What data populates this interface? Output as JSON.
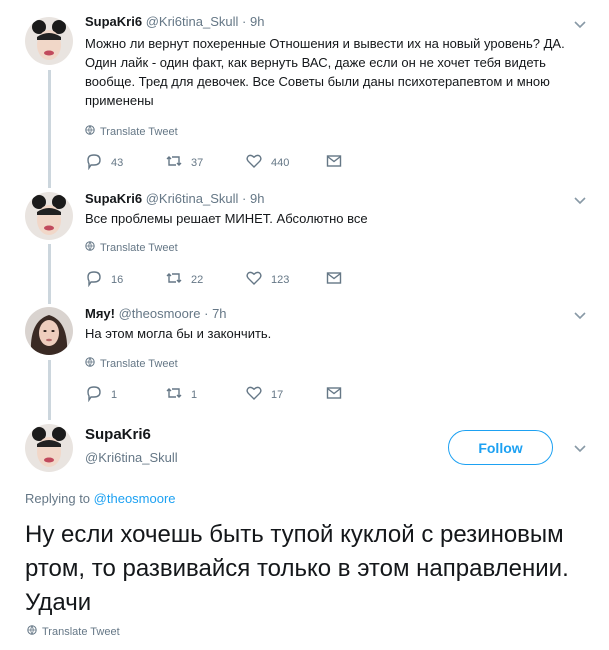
{
  "tweets": [
    {
      "name": "SupaKri6",
      "handle": "@Kri6tina_Skull",
      "sep": "·",
      "time": "9h",
      "text": "Можно ли вернут похеренные Отношения и вывести их на новый уровень? ДА. Один лайк - один факт, как вернуть ВАС, даже если он не хочет тебя видеть вообще. Тред для девочек. Все Советы были даны психотерапевтом и мною применены",
      "translate": "Translate Tweet",
      "replies": "43",
      "retweets": "37",
      "likes": "440"
    },
    {
      "name": "SupaKri6",
      "handle": "@Kri6tina_Skull",
      "sep": "·",
      "time": "9h",
      "text": "Все проблемы решает МИНЕТ. Абсолютно все",
      "translate": "Translate Tweet",
      "replies": "16",
      "retweets": "22",
      "likes": "123"
    },
    {
      "name": "Мяу!",
      "handle": "@theosmoore",
      "sep": "·",
      "time": "7h",
      "text": "На этом могла бы и закончить.",
      "translate": "Translate Tweet",
      "replies": "1",
      "retweets": "1",
      "likes": "17"
    }
  ],
  "main": {
    "name": "SupaKri6",
    "handle": "@Kri6tina_Skull",
    "follow_label": "Follow",
    "replying_prefix": "Replying to",
    "replying_to": "@theosmoore",
    "text": "Ну если хочешь быть тупой куклой с резиновым ртом, то развивайся только в этом направлении. Удачи",
    "translate": "Translate Tweet"
  },
  "colors": {
    "accent": "#1da1f2",
    "muted": "#657786",
    "thread_line": "#ccd6dd"
  },
  "icons": [
    "reply-icon",
    "retweet-icon",
    "like-icon",
    "dm-icon",
    "globe-icon",
    "chevron-down-icon"
  ]
}
